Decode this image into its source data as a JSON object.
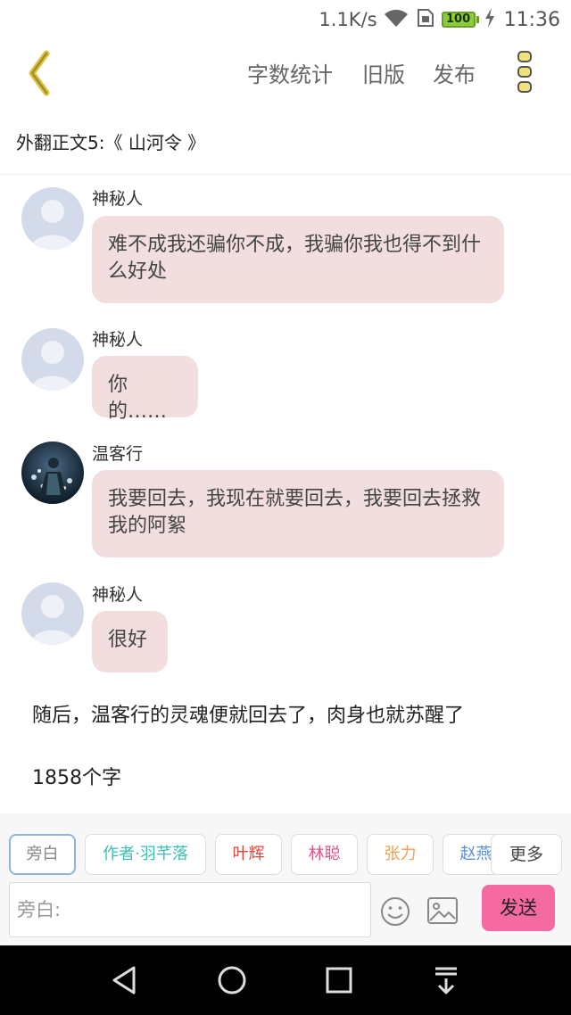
{
  "status_bar": {
    "speed": "1.1K/s",
    "battery": "100",
    "time": "11:36"
  },
  "top_nav": {
    "word_count": "字数统计",
    "old_version": "旧版",
    "publish": "发布"
  },
  "title": "外翻正文5:《 山河令 》",
  "messages": [
    {
      "sender": "神秘人",
      "text": "难不成我还骗你不成，我骗你我也得不到什么好处"
    },
    {
      "sender": "神秘人",
      "text": "你的……"
    },
    {
      "sender": "温客行",
      "text": "我要回去，我现在就要回去，我要回去拯救我的阿絮"
    },
    {
      "sender": "神秘人",
      "text": "很好"
    }
  ],
  "narration": "随后，温客行的灵魂便就回去了，肉身也就苏醒了",
  "word_count_text": "1858个字",
  "role_chips": [
    {
      "label": "旁白",
      "color": "#888888"
    },
    {
      "label": "作者·羽芊落",
      "color": "#3bbfb2"
    },
    {
      "label": "叶辉",
      "color": "#e0453a"
    },
    {
      "label": "林聪",
      "color": "#e0508a"
    },
    {
      "label": "张力",
      "color": "#f0a050"
    },
    {
      "label": "赵燕",
      "color": "#5b8fd6"
    }
  ],
  "more_label": "更多",
  "input": {
    "placeholder": "旁白:"
  },
  "send_label": "发送",
  "colors": {
    "accent_yellow": "#e6cc44",
    "bubble": "#f2dede",
    "send_button": "#f56aa0"
  }
}
